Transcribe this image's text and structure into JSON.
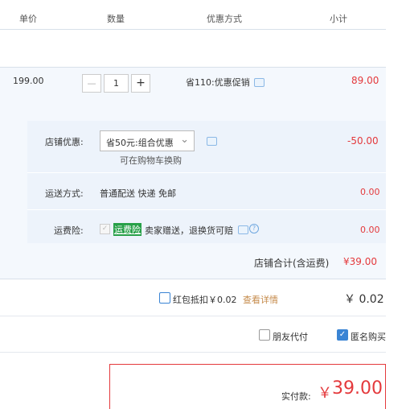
{
  "header": {
    "col_price": "单价",
    "col_qty": "数量",
    "col_promo": "优惠方式",
    "col_subtotal": "小计"
  },
  "item": {
    "price": "199.00",
    "qty_minus": "—",
    "qty": "1",
    "qty_plus": "+",
    "promo": "省110:优惠促销",
    "subtotal": "89.00"
  },
  "shop": {
    "discount_label": "店铺优惠:",
    "discount_select": "省50元:组合优惠",
    "discount_hint": "可在购物车换购",
    "discount_amount": "-50.00",
    "shipping_label": "运送方式:",
    "shipping_value": "普通配送 快递 免邮",
    "shipping_amount": "0.00",
    "insurance_label": "运费险:",
    "insurance_badge": "运费险",
    "insurance_text": "卖家赠送，退换货可赔",
    "insurance_amount": "0.00",
    "total_label": "店铺合计(含运费)",
    "total_value": "¥39.00"
  },
  "redpacket": {
    "label": "红包抵扣￥0.02",
    "link": "查看详情",
    "amount": "￥ 0.02"
  },
  "options": {
    "friend_pay": "朋友代付",
    "anonymous": "匿名购买"
  },
  "payment": {
    "label": "实付款:",
    "currency": "￥",
    "amount": "39.00"
  },
  "colors": {
    "accent_red": "#e4393c",
    "accent_blue": "#3a84d4",
    "row_bg": "#f4f8fd"
  }
}
